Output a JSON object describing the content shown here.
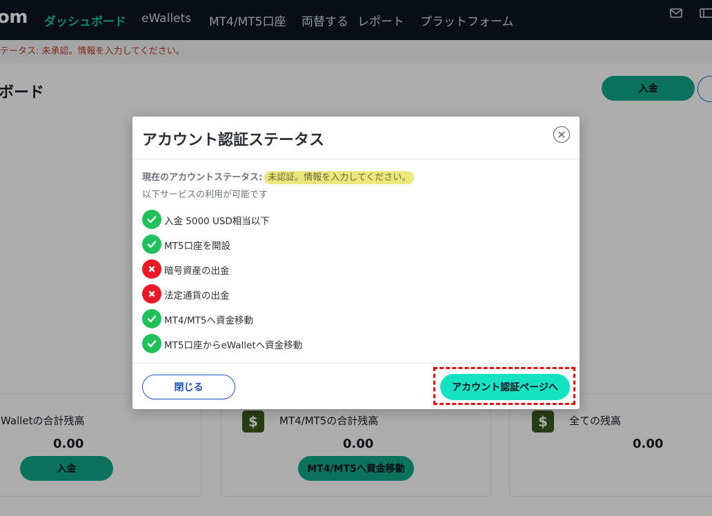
{
  "nav": {
    "logo": "om",
    "links": [
      "ダッシュボード",
      "eWallets",
      "MT4/MT5口座",
      "両替する",
      "レポート",
      "プラットフォーム"
    ]
  },
  "alert": "テータス: 未承認。情報を入力してください。",
  "page": {
    "title": "ボード",
    "deposit_label": "入金"
  },
  "cards": [
    {
      "title": "Walletの合計残高",
      "amount": "0.00",
      "button": "入金"
    },
    {
      "title": "MT4/MT5の合計残高",
      "amount": "0.00",
      "button": "MT4/MT5へ資金移動"
    },
    {
      "title": "全ての残高",
      "amount": "0.00"
    }
  ],
  "modal": {
    "title": "アカウント認証ステータス",
    "status_label": "現在のアカウントステータス:",
    "status_value": "未認証。情報を入力してください。",
    "available_text": "以下サービスの利用が可能です",
    "services": [
      {
        "label": "入金 5000 USD相当以下",
        "allowed": true
      },
      {
        "label": "MT5口座を開設",
        "allowed": true
      },
      {
        "label": "暗号資産の出金",
        "allowed": false
      },
      {
        "label": "法定通貨の出金",
        "allowed": false
      },
      {
        "label": "MT4/MT5へ資金移動",
        "allowed": true
      },
      {
        "label": "MT5口座からeWalletへ資金移動",
        "allowed": true
      }
    ],
    "close_button": "閉じる",
    "verify_button": "アカウント認証ページへ"
  },
  "colors": {
    "accent": "#10a989",
    "allowed": "#21c05c",
    "denied": "#e81a25",
    "highlight": "#e01010"
  }
}
